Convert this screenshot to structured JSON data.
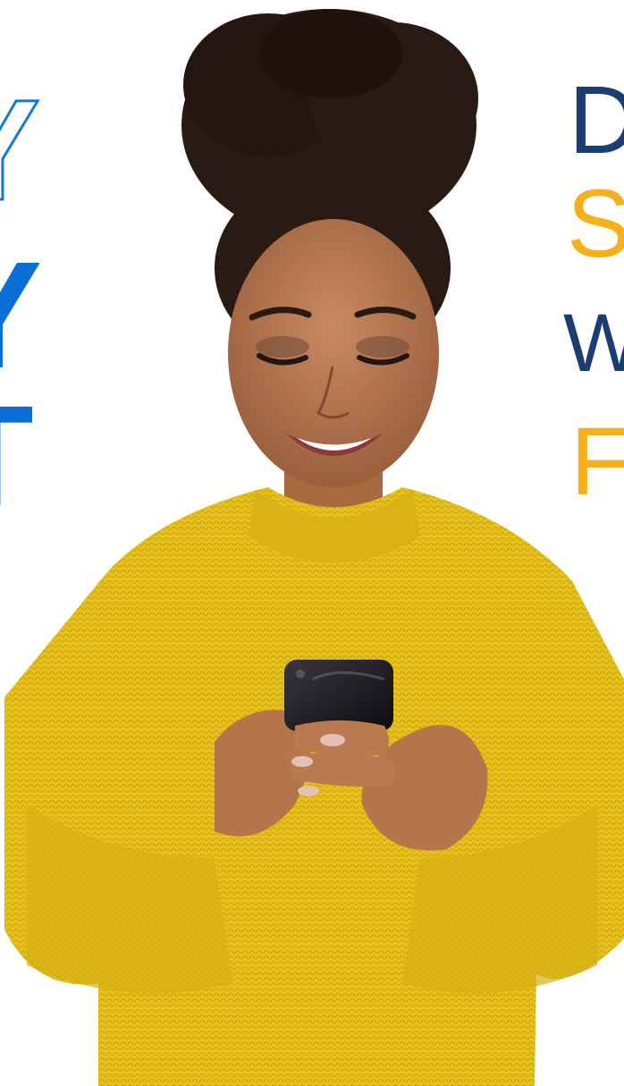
{
  "left_letters": {
    "line1": "Y",
    "line2": "Y",
    "line3": "T"
  },
  "right_letters": {
    "line1": "D",
    "line2": "S",
    "line3": "W",
    "line4": "F"
  },
  "colors": {
    "blue": "#0a6fd6",
    "navy": "#1b3d73",
    "gold": "#f5b11d",
    "sweater": "#e8c21a"
  },
  "image": {
    "subject": "smiling-woman-yellow-sweater-phone"
  }
}
